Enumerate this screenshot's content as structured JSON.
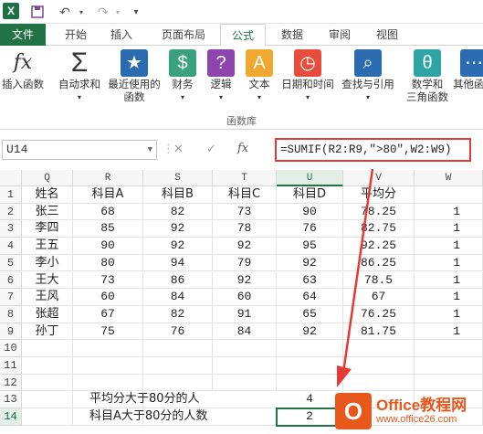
{
  "titlebar": {
    "app_icon": "X",
    "save_icon": "save-icon",
    "undo_icon": "undo-icon",
    "redo_icon": "redo-icon"
  },
  "tabs": [
    {
      "label": "文件"
    },
    {
      "label": "开始"
    },
    {
      "label": "插入"
    },
    {
      "label": "页面布局"
    },
    {
      "label": "公式"
    },
    {
      "label": "数据"
    },
    {
      "label": "审阅"
    },
    {
      "label": "视图"
    }
  ],
  "ribbon": {
    "buttons": [
      {
        "label1": "插入函数",
        "label2": "",
        "icon": "fx",
        "color": "#ffffff"
      },
      {
        "label1": "自动求和",
        "label2": "",
        "icon": "Σ",
        "color": "#ffffff"
      },
      {
        "label1": "最近使用的",
        "label2": "函数",
        "icon": "★",
        "color": "#2b6cb0"
      },
      {
        "label1": "财务",
        "label2": "",
        "icon": "$",
        "color": "#3aa17e"
      },
      {
        "label1": "逻辑",
        "label2": "",
        "icon": "?",
        "color": "#8e44ad"
      },
      {
        "label1": "文本",
        "label2": "",
        "icon": "A",
        "color": "#f0a830"
      },
      {
        "label1": "日期和时间",
        "label2": "",
        "icon": "◷",
        "color": "#e74c3c"
      },
      {
        "label1": "查找与引用",
        "label2": "",
        "icon": "⌕",
        "color": "#2b6cb0"
      },
      {
        "label1": "数学和",
        "label2": "三角函数",
        "icon": "θ",
        "color": "#2ea4a4"
      },
      {
        "label1": "其他函",
        "label2": "",
        "icon": "⋯",
        "color": "#2b6cb0"
      }
    ],
    "group_label": "函数库"
  },
  "formula_bar": {
    "name_box": "U14",
    "cancel": "✕",
    "enter": "✓",
    "fx": "fx",
    "formula": "=SUMIF(R2:R9,\">80\",W2:W9)"
  },
  "columns": [
    "Q",
    "R",
    "S",
    "T",
    "U",
    "V",
    "W"
  ],
  "rows": [
    "1",
    "2",
    "3",
    "4",
    "5",
    "6",
    "7",
    "8",
    "9",
    "10",
    "11",
    "12",
    "13",
    "14"
  ],
  "table": {
    "header": [
      "姓名",
      "科目A",
      "科目B",
      "科目C",
      "科目D",
      "平均分",
      ""
    ],
    "data": [
      [
        "张三",
        "68",
        "82",
        "73",
        "90",
        "78.25",
        "1"
      ],
      [
        "李四",
        "85",
        "92",
        "78",
        "76",
        "82.75",
        "1"
      ],
      [
        "王五",
        "90",
        "92",
        "92",
        "95",
        "92.25",
        "1"
      ],
      [
        "李小",
        "80",
        "94",
        "79",
        "92",
        "86.25",
        "1"
      ],
      [
        "王大",
        "73",
        "86",
        "92",
        "63",
        "78.5",
        "1"
      ],
      [
        "王风",
        "60",
        "84",
        "60",
        "64",
        "67",
        "1"
      ],
      [
        "张超",
        "67",
        "82",
        "91",
        "65",
        "76.25",
        "1"
      ],
      [
        "孙丁",
        "75",
        "76",
        "84",
        "92",
        "81.75",
        "1"
      ]
    ]
  },
  "summary": [
    {
      "label": "平均分大于80分的人",
      "value": "4"
    },
    {
      "label": "科目A大于80分的人数",
      "value": "2"
    }
  ],
  "watermark": {
    "title": "Office教程网",
    "url": "www.office26.com"
  },
  "colors": {
    "accent": "#217346",
    "highlight": "#e53935",
    "watermark": "#e8581c"
  }
}
